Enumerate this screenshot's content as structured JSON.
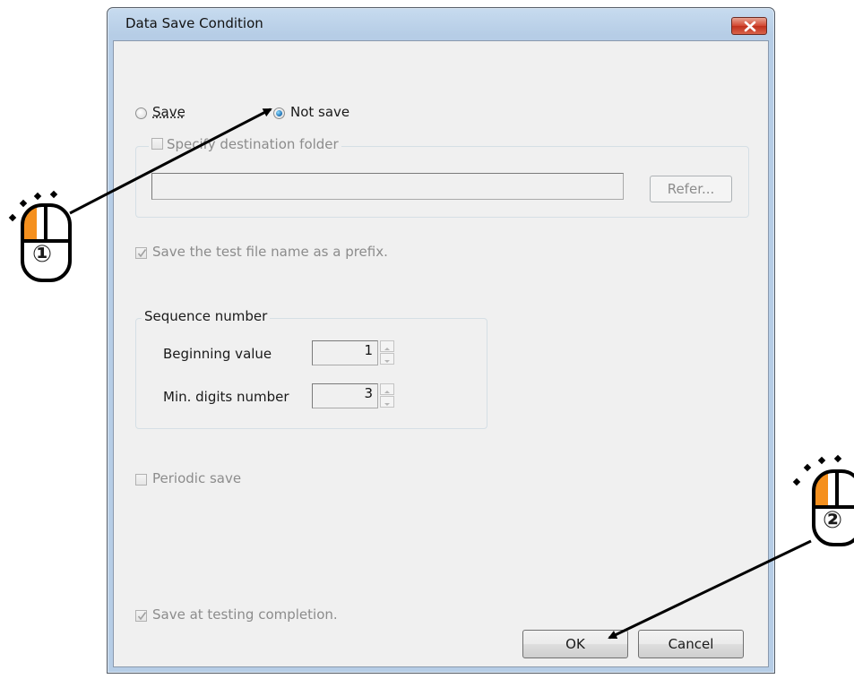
{
  "dialog": {
    "title": "Data Save Condition",
    "save_mode": {
      "option_save": "Save",
      "option_not_save": "Not save",
      "selected": "Not save"
    },
    "destination": {
      "checkbox_label": "Specify destination folder",
      "path_value": "",
      "refer_button": "Refer..."
    },
    "prefix_checkbox": "Save the test file name as a prefix.",
    "sequence": {
      "group_title": "Sequence number",
      "beginning_label": "Beginning value",
      "beginning_value": "1",
      "min_digits_label": "Min. digits number",
      "min_digits_value": "3"
    },
    "periodic_checkbox": "Periodic save",
    "completion_checkbox": "Save at testing completion.",
    "ok_button": "OK",
    "cancel_button": "Cancel"
  },
  "annotations": {
    "step1_label": "①",
    "step2_label": "②",
    "mouse_highlight_color": "#f5901e"
  }
}
